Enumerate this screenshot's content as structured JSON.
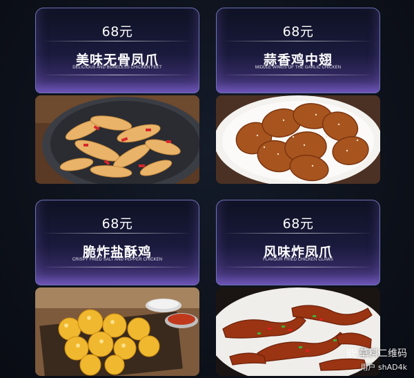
{
  "cards": [
    {
      "price": "68元",
      "name": "美味无骨凤爪",
      "subtitle": "DELICIOUS AND BONELESS CHICKEN FEET"
    },
    {
      "price": "68元",
      "name": "蒜香鸡中翅",
      "subtitle": "MIDDLE WINGS OF THE GARLIC CHICKEN"
    },
    {
      "price": "68元",
      "name": "脆炸盐酥鸡",
      "subtitle": "CRISPY FRIED SALT AND PEPPER CHICKEN"
    },
    {
      "price": "68元",
      "name": "风味炸凤爪",
      "subtitle": "FLAVOUR FRIED CHICKEN CLAWS"
    }
  ],
  "watermark": {
    "line1": "草料二维码",
    "line2": "用户 shAD4k"
  },
  "colors": {
    "background": "#0d121c",
    "card_border": "#6d73b8",
    "card_glow": "#5d49a3"
  }
}
